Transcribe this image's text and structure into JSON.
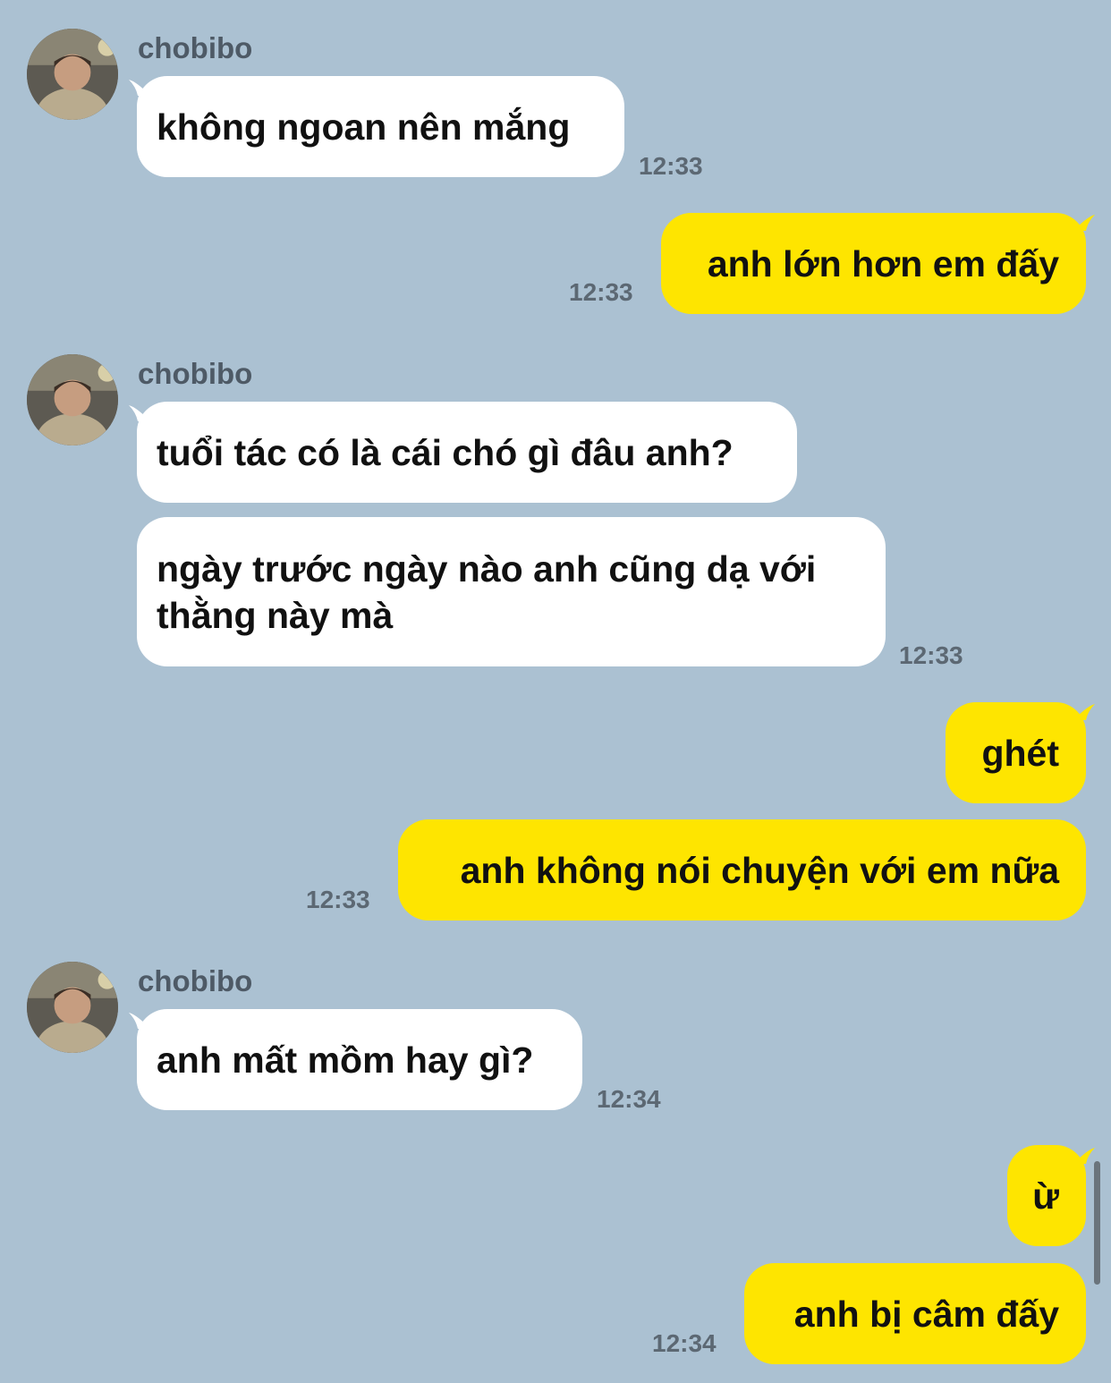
{
  "colors": {
    "background": "#abc1d2",
    "incoming_bubble": "#ffffff",
    "outgoing_bubble": "#fee500",
    "timestamp": "#5c6873",
    "sender_name": "#4e5a66"
  },
  "messages": [
    {
      "sender": "chobibo",
      "text": "không ngoan nên mắng",
      "time": "12:33"
    },
    {
      "text": "anh lớn hơn em đấy",
      "time": "12:33"
    },
    {
      "sender": "chobibo",
      "text": "tuổi tác có là cái chó gì đâu anh?"
    },
    {
      "text": "ngày trước ngày nào anh cũng dạ với thằng này mà",
      "time": "12:33"
    },
    {
      "text": "ghét"
    },
    {
      "text": "anh không nói chuyện với em nữa",
      "time": "12:33"
    },
    {
      "sender": "chobibo",
      "text": "anh mất mồm hay gì?",
      "time": "12:34"
    },
    {
      "text": "ừ"
    },
    {
      "text": "anh bị câm đấy",
      "time": "12:34"
    }
  ],
  "icons": {
    "avatar": "profile-photo-avatar"
  }
}
